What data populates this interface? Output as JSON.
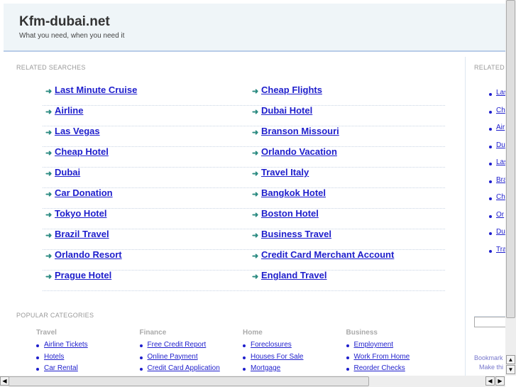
{
  "header": {
    "title": "Kfm-dubai.net",
    "tagline": "What you need, when you need it"
  },
  "related": {
    "heading": "RELATED SEARCHES",
    "left": [
      "Last Minute Cruise",
      "Airline",
      "Las Vegas",
      "Cheap Hotel",
      "Dubai",
      "Car Donation",
      "Tokyo Hotel",
      "Brazil Travel",
      "Orlando Resort",
      "Prague Hotel"
    ],
    "right": [
      "Cheap Flights",
      "Dubai Hotel",
      "Branson Missouri",
      "Orlando Vacation",
      "Travel Italy",
      "Bangkok Hotel",
      "Boston Hotel",
      "Business Travel",
      "Credit Card Merchant Account",
      "England Travel"
    ]
  },
  "sidebar": {
    "heading": "RELATED",
    "items": [
      "Las",
      "Ch",
      "Air",
      "Du",
      "Las",
      "Bra",
      "Ch",
      "Or",
      "Du",
      "Tra"
    ],
    "bookmark": "Bookmark",
    "make": "Make thi"
  },
  "popular": {
    "heading": "POPULAR CATEGORIES",
    "columns": [
      {
        "title": "Travel",
        "items": [
          "Airline Tickets",
          "Hotels",
          "Car Rental"
        ]
      },
      {
        "title": "Finance",
        "items": [
          "Free Credit Report",
          "Online Payment",
          "Credit Card Application"
        ]
      },
      {
        "title": "Home",
        "items": [
          "Foreclosures",
          "Houses For Sale",
          "Mortgage"
        ]
      },
      {
        "title": "Business",
        "items": [
          "Employment",
          "Work From Home",
          "Reorder Checks"
        ]
      }
    ]
  },
  "colors": {
    "link": "#1e1ecc",
    "arrow": "#2a8a80",
    "header_bg": "#eff5f8"
  }
}
